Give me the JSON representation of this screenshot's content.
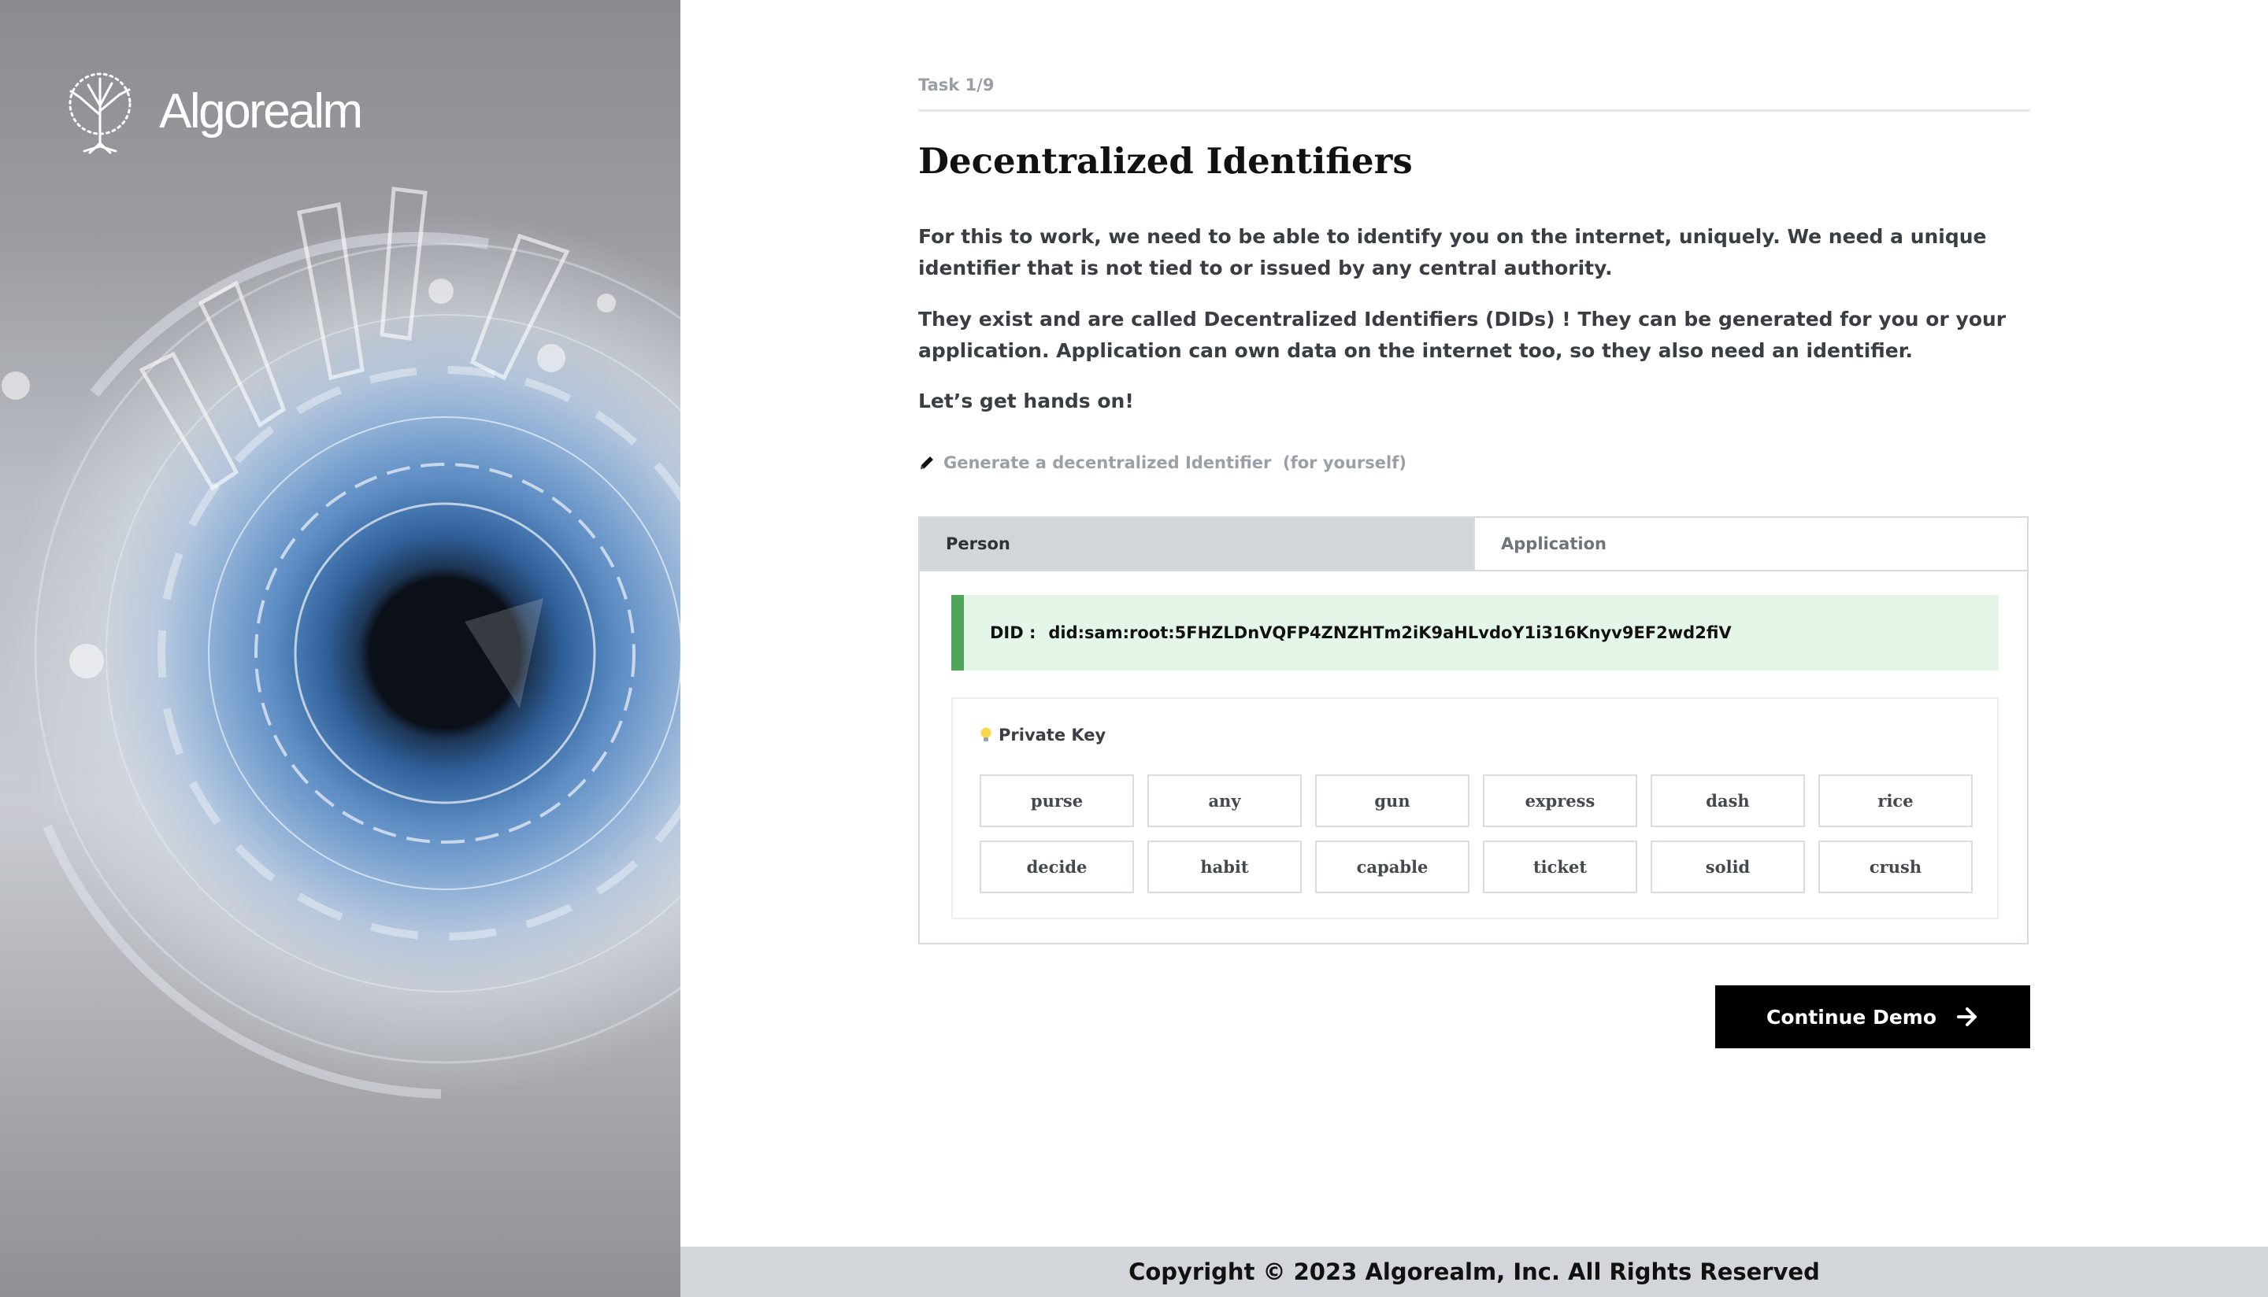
{
  "brand": {
    "name": "Algorealm"
  },
  "task": {
    "label": "Task 1/9"
  },
  "heading": "Decentralized Identifiers",
  "paragraphs": [
    "For this to work, we need to be able to identify you on the internet, uniquely. We need a unique identifier that is not tied to or issued by any central authority.",
    "They exist and are called Decentralized Identifiers (DIDs) ! They can be generated for you or your application. Application can own data on the internet too, so they also need an identifier.",
    "Let’s get hands on!"
  ],
  "generate_link": {
    "label": "Generate a decentralized Identifier  (for yourself)",
    "icon": "pencil-icon"
  },
  "tabs": [
    {
      "label": "Person",
      "active": true
    },
    {
      "label": "Application",
      "active": false
    }
  ],
  "did": {
    "label": "DID :",
    "value": "did:sam:root:5FHZLDnVQFP4ZNZHTm2iK9aHLvdoY1i316Knyv9EF2wd2fiV"
  },
  "private_key": {
    "title": "Private Key",
    "icon": "lightbulb-icon",
    "words": [
      "purse",
      "any",
      "gun",
      "express",
      "dash",
      "rice",
      "decide",
      "habit",
      "capable",
      "ticket",
      "solid",
      "crush"
    ]
  },
  "continue_button": {
    "label": "Continue Demo",
    "icon": "arrow-right-icon"
  },
  "footer": {
    "text": "Copyright © 2023 Algorealm, Inc. All Rights Reserved"
  },
  "colors": {
    "accent_green": "#4fa55a",
    "did_background": "#e3f6e8",
    "tab_active": "#d2d5da",
    "button": "#000000"
  }
}
